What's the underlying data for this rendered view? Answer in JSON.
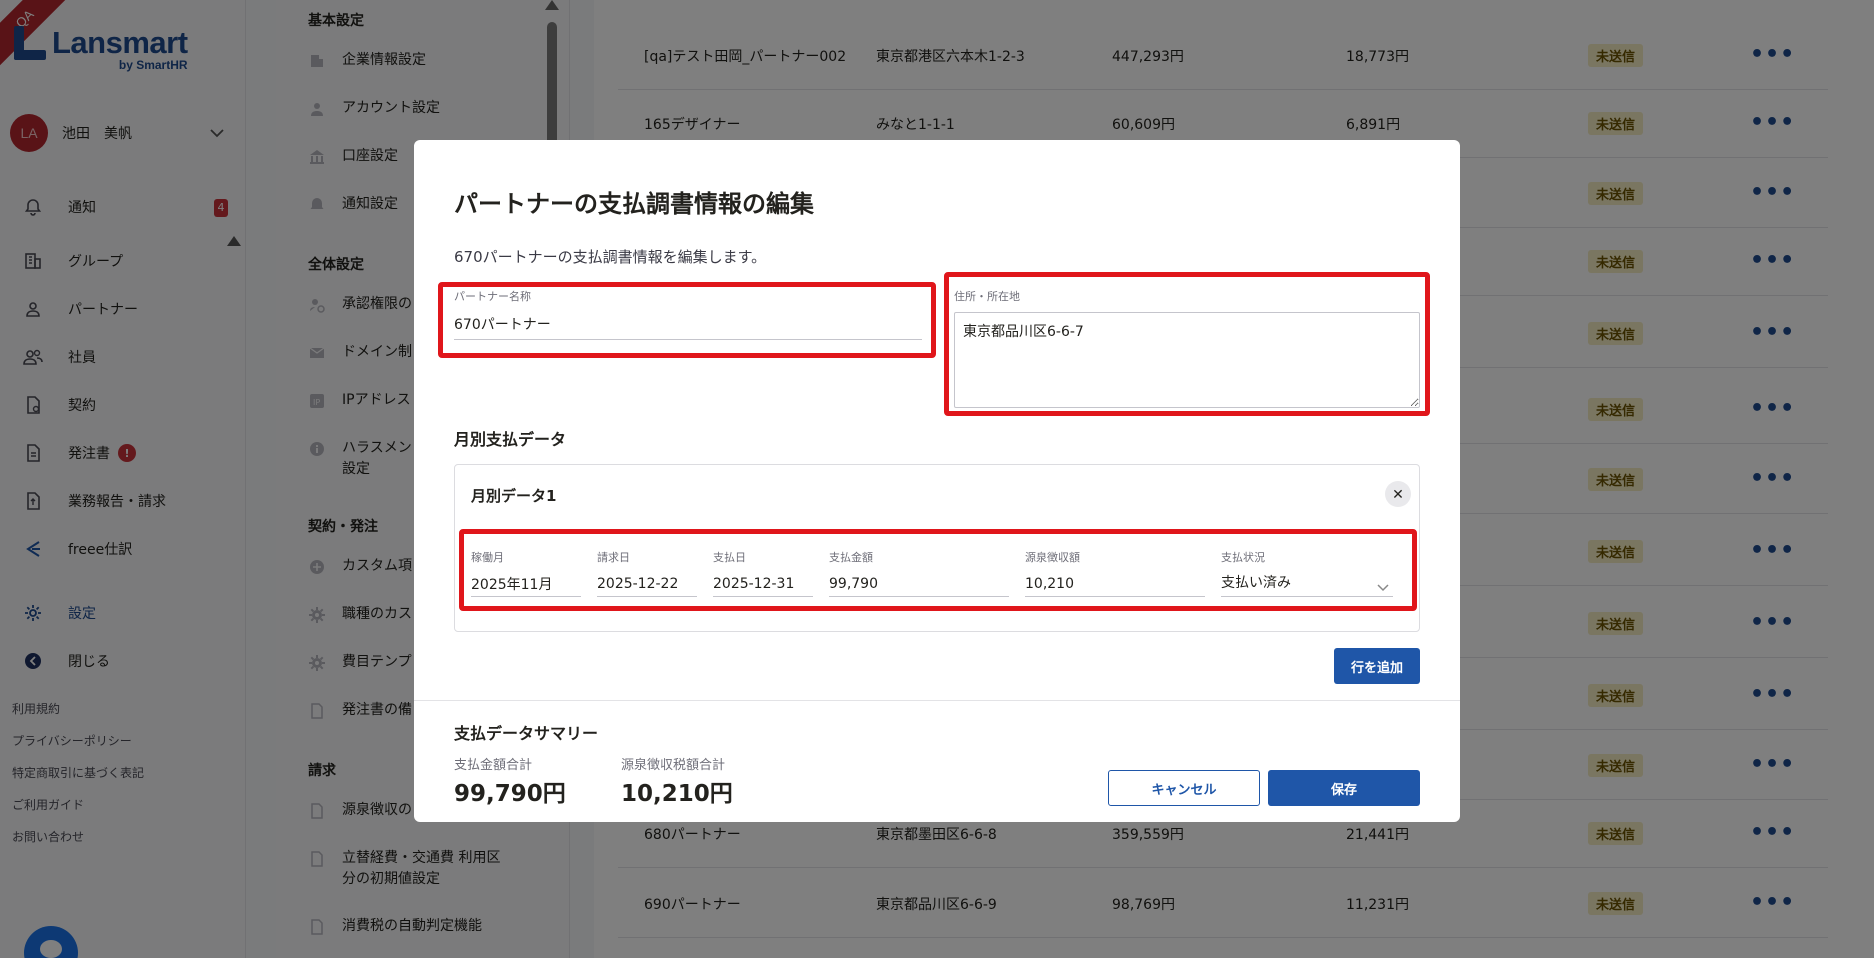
{
  "qa_ribbon": "QA",
  "brand": {
    "name": "Lansmart",
    "sub": "by SmartHR"
  },
  "user": {
    "initials": "LA",
    "name": "池田　美帆"
  },
  "nav": [
    {
      "label": "通知",
      "icon": "bell-icon",
      "badge": "4"
    },
    {
      "label": "グループ",
      "icon": "building-icon"
    },
    {
      "label": "パートナー",
      "icon": "person-icon"
    },
    {
      "label": "社員",
      "icon": "people-icon"
    },
    {
      "label": "契約",
      "icon": "contract-icon"
    },
    {
      "label": "発注書",
      "icon": "document-icon",
      "alert": "!"
    },
    {
      "label": "業務報告・請求",
      "icon": "report-icon"
    },
    {
      "label": "freee仕訳",
      "icon": "freee-icon"
    },
    {
      "label": "設定",
      "icon": "gear-icon"
    },
    {
      "label": "閉じる",
      "icon": "close-arrow-icon"
    }
  ],
  "footer_links": [
    "利用規約",
    "プライバシーポリシー",
    "特定商取引に基づく表記",
    "ご利用ガイド",
    "お問い合わせ"
  ],
  "settings": {
    "basic_head": "基本設定",
    "basic_items": [
      "企業情報設定",
      "アカウント設定",
      "口座設定",
      "通知設定"
    ],
    "global_head": "全体設定",
    "global_items": [
      "承認権限の",
      "ドメイン制",
      "IPアドレス",
      "ハラスメン\n設定"
    ],
    "contract_head": "契約・発注",
    "contract_items": [
      "カスタム項",
      "職種のカス",
      "費目テンプ",
      "発注書の備"
    ],
    "billing_head": "請求",
    "billing_items": [
      "源泉徴収の",
      "立替経費・交通費 利用区分の初期値設定",
      "消費税の自動判定機能"
    ]
  },
  "table_rows": [
    {
      "name": "[qa]テスト田岡_パートナー002",
      "address": "東京都港区六本木1-2-3",
      "amount": "447,293円",
      "tax": "18,773円",
      "status": "未送信"
    },
    {
      "name": "165デザイナー",
      "address": "みなと1-1-1",
      "amount": "60,609円",
      "tax": "6,891円",
      "status": "未送信"
    },
    {
      "name": "",
      "address": "",
      "amount": "",
      "tax": "",
      "status": "未送信"
    },
    {
      "name": "",
      "address": "",
      "amount": "",
      "tax": "",
      "status": "未送信"
    },
    {
      "name": "",
      "address": "",
      "amount": "",
      "tax": "",
      "status": "未送信"
    },
    {
      "name": "",
      "address": "",
      "amount": "",
      "tax": "",
      "status": "未送信"
    },
    {
      "name": "",
      "address": "",
      "amount": "",
      "tax": "",
      "status": "未送信"
    },
    {
      "name": "",
      "address": "",
      "amount": "",
      "tax": "",
      "status": "未送信"
    },
    {
      "name": "",
      "address": "",
      "amount": "",
      "tax": "",
      "status": "未送信"
    },
    {
      "name": "",
      "address": "",
      "amount": "",
      "tax": "",
      "status": "未送信"
    },
    {
      "name": "",
      "address": "",
      "amount": "",
      "tax": "",
      "status": "未送信"
    },
    {
      "name": "680パートナー",
      "address": "東京都墨田区6-6-8",
      "amount": "359,559円",
      "tax": "21,441円",
      "status": "未送信"
    },
    {
      "name": "690パートナー",
      "address": "東京都品川区6-6-9",
      "amount": "98,769円",
      "tax": "11,231円",
      "status": "未送信"
    }
  ],
  "modal": {
    "title": "パートナーの支払調書情報の編集",
    "description": "670パートナーの支払調書情報を編集します。",
    "partner_name_label": "パートナー名称",
    "partner_name_value": "670パートナー",
    "address_label": "住所・所在地",
    "address_value": "東京都品川区6-6-7",
    "monthly_section_title": "月別支払データ",
    "monthly_card_title": "月別データ1",
    "monthly_fields": {
      "work_month_label": "稼働月",
      "work_month_value": "2025年11月",
      "invoice_date_label": "請求日",
      "invoice_date_value": "2025-12-22",
      "payment_date_label": "支払日",
      "payment_date_value": "2025-12-31",
      "payment_amount_label": "支払金額",
      "payment_amount_value": "99,790",
      "withholding_label": "源泉徴収額",
      "withholding_value": "10,210",
      "status_label": "支払状況",
      "status_value": "支払い済み"
    },
    "add_row_label": "行を追加",
    "summary_title": "支払データサマリー",
    "summary_total_label": "支払金額合計",
    "summary_total_value": "99,790円",
    "summary_tax_label": "源泉徴収税額合計",
    "summary_tax_value": "10,210円",
    "cancel_label": "キャンセル",
    "save_label": "保存"
  }
}
